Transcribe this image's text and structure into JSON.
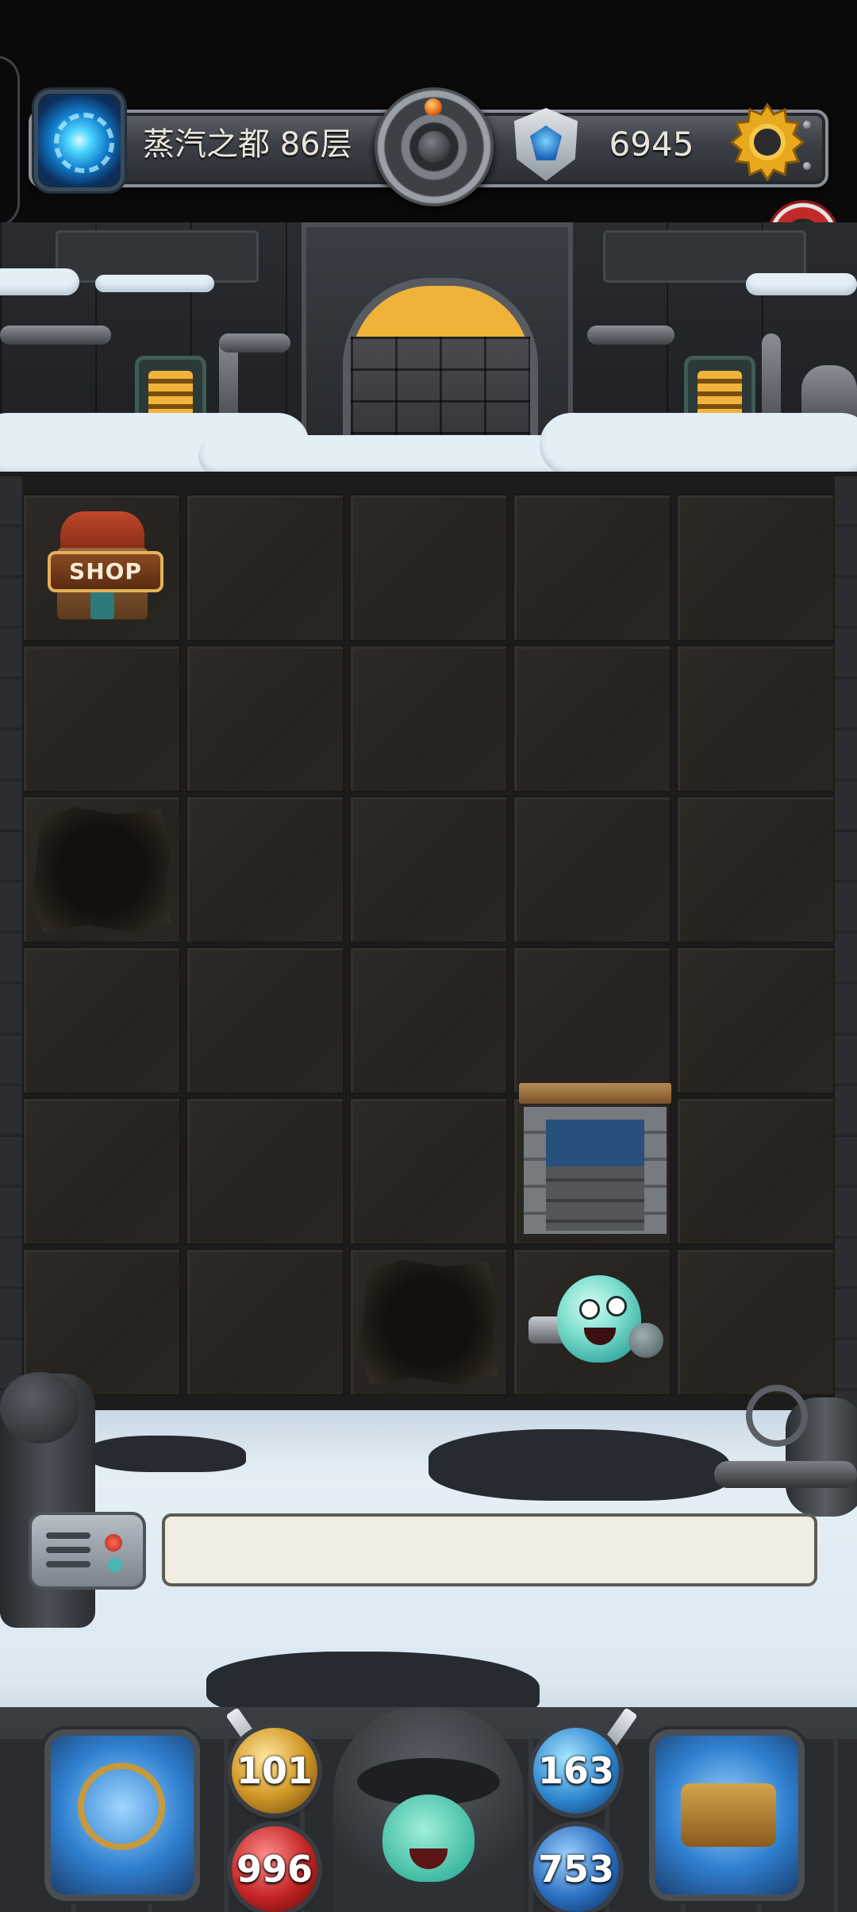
{
  "hud": {
    "floor_label": "蒸汽之都 86层",
    "coins": "6945",
    "icons": {
      "portal": "portal-icon",
      "center_gear": "steam-gear-icon",
      "badge": "shield-badge-icon",
      "settings": "gear-icon",
      "avatar": "pet-avatar-icon"
    }
  },
  "board": {
    "columns": 5,
    "rows": 6,
    "special_tiles": [
      {
        "name": "shop",
        "label": "SHOP"
      },
      {
        "name": "hole-1"
      },
      {
        "name": "stairs-down"
      },
      {
        "name": "hole-2"
      },
      {
        "name": "hero"
      }
    ]
  },
  "dialog": {
    "text": ""
  },
  "stats": {
    "attack": "101",
    "hp": "996",
    "defense": "163",
    "mp": "753"
  },
  "colors": {
    "hud_text": "#e9e5dc",
    "gold": "#f1b43a",
    "tile": "#2a2723"
  }
}
